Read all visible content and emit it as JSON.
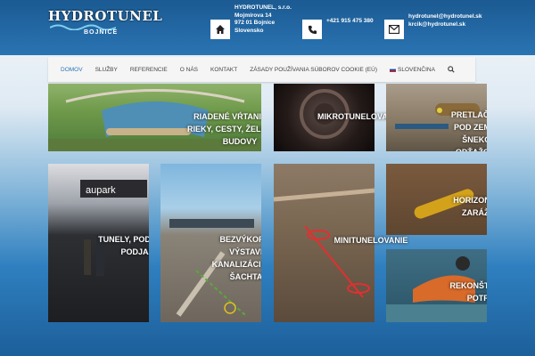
{
  "header": {
    "logo_text": "HYDROTUNEL",
    "logo_subtitle": "BOJNICE",
    "address_lines": [
      "HYDROTUNEL, s.r.o.",
      "Mojmírova 14",
      "972 01 Bojnice",
      "Slovensko"
    ],
    "phone": "+421 915 475 380",
    "emails": [
      "hydrotunel@hydrotunel.sk",
      "krcik@hydrotunel.sk"
    ],
    "icons": [
      "home-icon",
      "phone-icon",
      "envelope-icon"
    ]
  },
  "nav": {
    "items": [
      "DOMOV",
      "SLUŽBY",
      "REFERENCIE",
      "O NÁS",
      "KONTAKT",
      "ZÁSADY POUŽÍVANIA SÚBOROV COOKIE (EÚ)",
      "SLOVENČINA"
    ],
    "active_index": 0,
    "search_icon": "search-icon"
  },
  "tiles": [
    {
      "label": "RIADENÉ VŔTANIE POD RIEKY, CESTY, ŽELEZNICE, BUDOVY"
    },
    {
      "label": "MIKROTUNELOVANIE"
    },
    {
      "label": "PRETLAČOVANIE POD ZEMOU SO ŠNEKOVÝM ODŤAŽOVANÍM"
    },
    {
      "label": "TUNELY, PODCHODY A PODJAZDY"
    },
    {
      "label": "BEZVÝKOPOVÁ VÝSTAVBA KANALIZÁCII AJ SO ŠACHTAMI"
    },
    {
      "label": "MINITUNELOVANIE"
    },
    {
      "label": "HORIZONTÁLNE ZARÁŽANIE"
    },
    {
      "label": "REKONŠTRUKCIA POTRUBÍ"
    }
  ],
  "colors": {
    "header_bg": "#1b5a92",
    "nav_active": "#2a74b3"
  }
}
